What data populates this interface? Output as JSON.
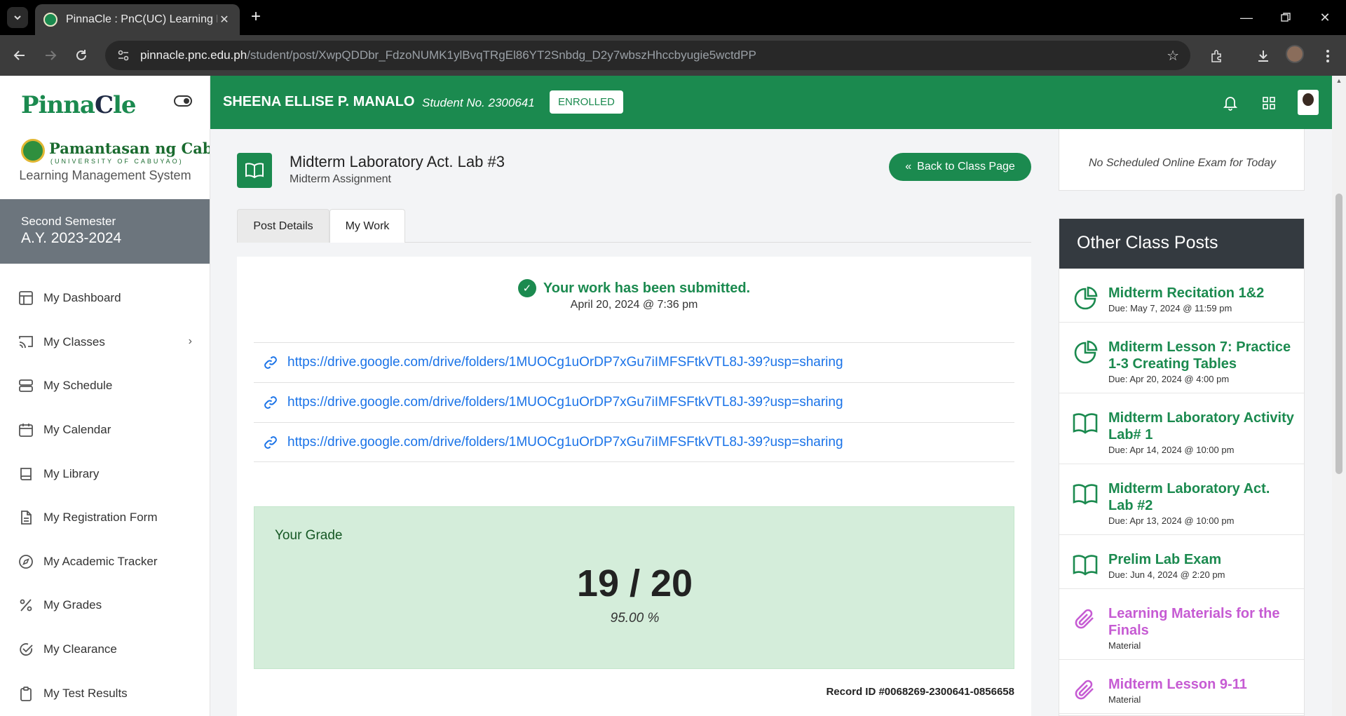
{
  "browser": {
    "tab_title": "PinnaCle : PnC(UC) Learning Ma",
    "url_host": "pinnacle.pnc.edu.ph",
    "url_path": "/student/post/XwpQDDbr_FdzoNUMK1ylBvqTRgEl86YT2Snbdg_D2y7wbszHhccbyugie5wctdPP"
  },
  "sidebar": {
    "brand_prefix": "Pinna",
    "brand_accent": "C",
    "brand_suffix": "le",
    "university_name": "Pamantasan ng Cabuyao",
    "university_sub": "(UNIVERSITY OF CABUYAO)",
    "lms_label": "Learning Management System",
    "semester": "Second Semester",
    "academic_year": "A.Y. 2023-2024",
    "items": [
      {
        "label": "My Dashboard",
        "icon": "dashboard-icon"
      },
      {
        "label": "My Classes",
        "icon": "classes-icon"
      },
      {
        "label": "My Schedule",
        "icon": "schedule-icon"
      },
      {
        "label": "My Calendar",
        "icon": "calendar-icon"
      },
      {
        "label": "My Library",
        "icon": "library-icon"
      },
      {
        "label": "My Registration Form",
        "icon": "registration-icon"
      },
      {
        "label": "My Academic Tracker",
        "icon": "compass-icon"
      },
      {
        "label": "My Grades",
        "icon": "percent-icon"
      },
      {
        "label": "My Clearance",
        "icon": "check-circle-icon"
      },
      {
        "label": "My Test Results",
        "icon": "clipboard-icon"
      }
    ]
  },
  "header": {
    "student_name": "SHEENA ELLISE P. MANALO",
    "student_no": "Student No. 2300641",
    "status": "ENROLLED"
  },
  "post": {
    "title": "Midterm Laboratory Act. Lab #3",
    "subtitle": "Midterm Assignment",
    "back_label": "Back to Class Page",
    "tabs": [
      "Post Details",
      "My Work"
    ],
    "active_tab": "My Work"
  },
  "work": {
    "status": "Your work has been submitted.",
    "submitted_at": "April 20, 2024 @ 7:36 pm",
    "links": [
      "https://drive.google.com/drive/folders/1MUOCg1uOrDP7xGu7iIMFSFtkVTL8J-39?usp=sharing",
      "https://drive.google.com/drive/folders/1MUOCg1uOrDP7xGu7iIMFSFtkVTL8J-39?usp=sharing",
      "https://drive.google.com/drive/folders/1MUOCg1uOrDP7xGu7iIMFSFtkVTL8J-39?usp=sharing"
    ],
    "grade_label": "Your Grade",
    "grade_score": "19 / 20",
    "grade_percent": "95.00 %",
    "record_id": "Record ID #0068269-2300641-0856658"
  },
  "right": {
    "exam_notice": "No Scheduled Online Exam for Today",
    "other_posts_title": "Other Class Posts",
    "posts": [
      {
        "title": "Midterm Recitation 1&2",
        "due": "Due: May 7, 2024 @ 11:59 pm",
        "kind": "pie"
      },
      {
        "title": "Mditerm Lesson 7: Practice 1-3 Creating Tables",
        "due": "Due: Apr 20, 2024 @ 4:00 pm",
        "kind": "pie"
      },
      {
        "title": "Midterm Laboratory Activity Lab# 1",
        "due": "Due: Apr 14, 2024 @ 10:00 pm",
        "kind": "book"
      },
      {
        "title": "Midterm Laboratory Act. Lab #2",
        "due": "Due: Apr 13, 2024 @ 10:00 pm",
        "kind": "book"
      },
      {
        "title": "Prelim Lab Exam",
        "due": "Due: Jun 4, 2024 @ 2:20 pm",
        "kind": "book"
      },
      {
        "title": "Learning Materials for the Finals",
        "due": "Material",
        "kind": "paperclip"
      },
      {
        "title": "Midterm Lesson 9-11",
        "due": "Material",
        "kind": "paperclip"
      }
    ]
  },
  "colors": {
    "brand_green": "#1b8a4f",
    "material_purple": "#c65bd3",
    "grade_bg": "#d4edda",
    "link_blue": "#1a73e8"
  }
}
